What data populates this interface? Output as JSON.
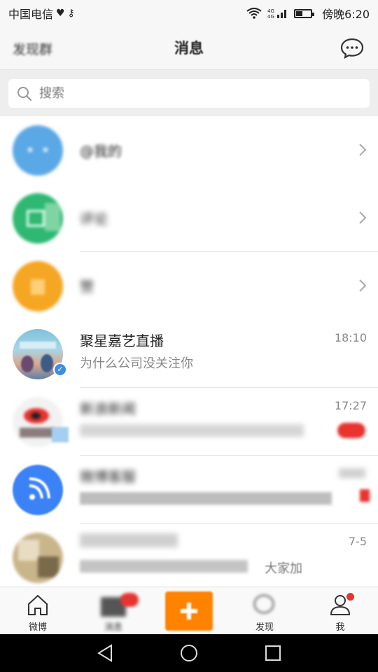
{
  "status_bar": {
    "carrier": "中国电信",
    "time": "傍晚6:20",
    "network": "4G"
  },
  "header": {
    "left_label": "发现群",
    "title": "消息"
  },
  "search": {
    "placeholder": "搜索"
  },
  "messages": [
    {
      "title": "@我的",
      "subtitle": "",
      "time": "",
      "avatar_color": "#5aa8e6"
    },
    {
      "title": "评论",
      "subtitle": "",
      "time": "",
      "avatar_color": "#2eb872"
    },
    {
      "title": "赞",
      "subtitle": "",
      "time": "",
      "avatar_color": "#f5a623"
    },
    {
      "title": "聚星嘉艺直播",
      "subtitle": "为什么公司没关注你",
      "time": "18:10",
      "avatar_color": "#8ec3d9"
    },
    {
      "title": "新浪新闻",
      "subtitle": "",
      "time": "17:27",
      "avatar_color": "#f2f2f2"
    },
    {
      "title": "微博客服",
      "subtitle": "",
      "time": "",
      "avatar_color": "#3b82f6"
    },
    {
      "title": "",
      "subtitle": "大家加",
      "time": "7-5",
      "avatar_color": "#c9b58a"
    }
  ],
  "tab_bar": {
    "tabs": [
      {
        "label": "微博"
      },
      {
        "label": "消息"
      },
      {
        "label": ""
      },
      {
        "label": "发现"
      },
      {
        "label": "我"
      }
    ]
  },
  "colors": {
    "accent": "#ff8200",
    "badge": "#e8332f",
    "verified": "#3b8de8"
  }
}
